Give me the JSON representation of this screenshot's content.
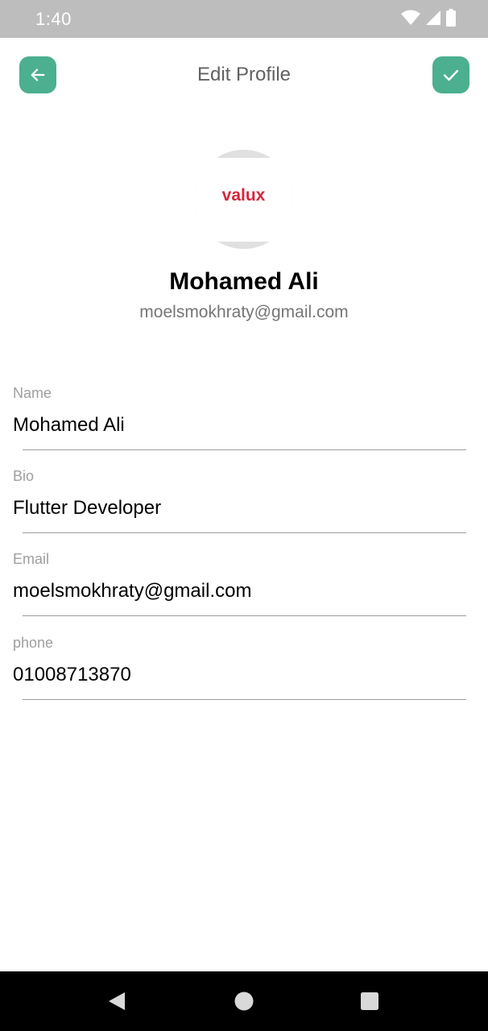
{
  "status_bar": {
    "time": "1:40",
    "icons": [
      "wifi-icon",
      "signal-icon",
      "battery-icon"
    ]
  },
  "app_bar": {
    "title": "Edit Profile",
    "back_icon": "arrow-left-icon",
    "confirm_icon": "check-icon"
  },
  "profile": {
    "avatar_logo": "valux",
    "name": "Mohamed Ali",
    "email": "moelsmokhraty@gmail.com"
  },
  "form": {
    "fields": [
      {
        "label": "Name",
        "value": "Mohamed Ali"
      },
      {
        "label": "Bio",
        "value": "Flutter Developer"
      },
      {
        "label": "Email",
        "value": "moelsmokhraty@gmail.com"
      },
      {
        "label": "phone",
        "value": "01008713870"
      }
    ]
  },
  "colors": {
    "accent": "#4caf8f",
    "logo_red": "#d7263d",
    "status_bar": "#bdbdbd",
    "nav_bar": "#000000"
  },
  "nav_bar": {
    "icons": [
      "back-triangle-icon",
      "home-circle-icon",
      "recents-square-icon"
    ]
  }
}
